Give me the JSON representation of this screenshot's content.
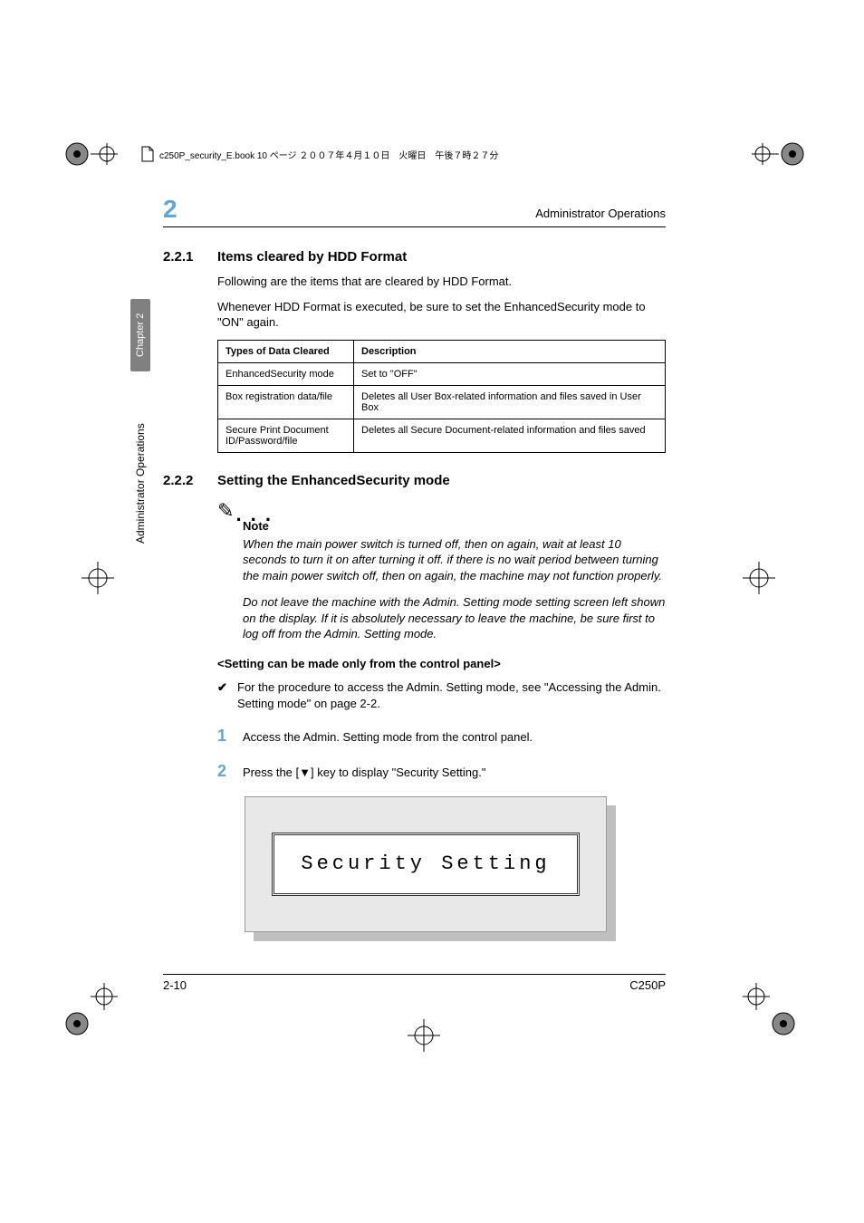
{
  "book_header": {
    "text": "c250P_security_E.book  10 ページ  ２００７年４月１０日　火曜日　午後７時２７分"
  },
  "running_head": {
    "chapter_number": "2",
    "title": "Administrator Operations"
  },
  "side": {
    "tab": "Chapter 2",
    "label": "Administrator Operations"
  },
  "section_221": {
    "number": "2.2.1",
    "title": "Items cleared by HDD Format",
    "para1": "Following are the items that are cleared by HDD Format.",
    "para2": "Whenever HDD Format is executed, be sure to set the EnhancedSecurity mode to \"ON\" again."
  },
  "table": {
    "head": {
      "c1": "Types of Data Cleared",
      "c2": "Description"
    },
    "rows": [
      {
        "c1": "EnhancedSecurity mode",
        "c2": "Set to \"OFF\""
      },
      {
        "c1": "Box registration data/file",
        "c2": "Deletes all User Box-related information and files saved in User Box"
      },
      {
        "c1": "Secure Print Document ID/Password/file",
        "c2": "Deletes all Secure Document-related information and files saved"
      }
    ]
  },
  "section_222": {
    "number": "2.2.2",
    "title": "Setting the EnhancedSecurity mode"
  },
  "note": {
    "label": "Note",
    "p1": "When the main power switch is turned off, then on again, wait at least 10 seconds to turn it on after turning it off. if there is no wait period between turning the main power switch off, then on again, the machine may not function properly.",
    "p2": "Do not leave the machine with the Admin. Setting mode setting screen left shown on the display. If it is absolutely necessary to leave the machine, be sure first to log off from the Admin. Setting mode."
  },
  "subhead": "<Setting can be made only from the control panel>",
  "check": {
    "mark": "✔",
    "text": "For the procedure to access the Admin. Setting mode, see \"Accessing the Admin. Setting mode\" on page 2-2."
  },
  "steps": {
    "s1": {
      "num": "1",
      "text": "Access the Admin. Setting mode from the control panel."
    },
    "s2": {
      "num": "2",
      "text": "Press the [▼] key to display \"Security Setting.\""
    }
  },
  "lcd": {
    "text": "Security Setting"
  },
  "footer": {
    "left": "2-10",
    "right": "C250P"
  }
}
